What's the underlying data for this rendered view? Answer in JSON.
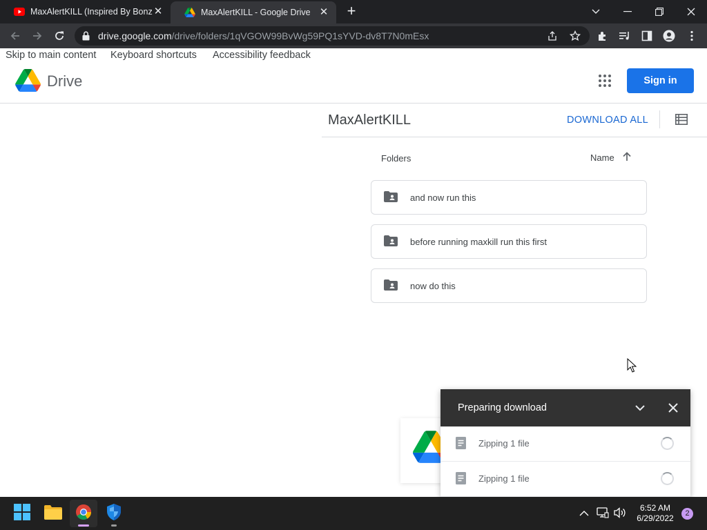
{
  "browser": {
    "tabs": [
      {
        "title": "MaxAlertKILL (Inspired By BonziKILL",
        "favicon": "youtube-icon",
        "active": false
      },
      {
        "title": "MaxAlertKILL - Google Drive",
        "favicon": "google-drive-icon",
        "active": true
      }
    ],
    "address": {
      "host": "drive.google.com",
      "path": "/drive/folders/1qVGOW99BvWg59PQ1sYVD-dv8T7N0mEsx"
    }
  },
  "page": {
    "skip_links": [
      "Skip to main content",
      "Keyboard shortcuts",
      "Accessibility feedback"
    ],
    "product_name": "Drive",
    "sign_in_label": "Sign in",
    "folder_title": "MaxAlertKILL",
    "download_all_label": "DOWNLOAD ALL",
    "section_label": "Folders",
    "sort_label": "Name",
    "folders": [
      {
        "name": "and now run this"
      },
      {
        "name": "before running maxkill run this first"
      },
      {
        "name": "now do this"
      }
    ]
  },
  "download_panel": {
    "title": "Preparing download",
    "items": [
      {
        "label": "Zipping 1 file"
      },
      {
        "label": "Zipping 1 file"
      }
    ]
  },
  "taskbar": {
    "apps": [
      "start-icon",
      "file-explorer-icon",
      "chrome-icon",
      "windows-security-icon"
    ],
    "time": "6:52 AM",
    "date": "6/29/2022",
    "notification_count": "2"
  },
  "colors": {
    "accent_blue": "#1a73e8",
    "link_blue": "#1967d2",
    "dark_panel": "#323232",
    "browser_frame": "#202124"
  }
}
